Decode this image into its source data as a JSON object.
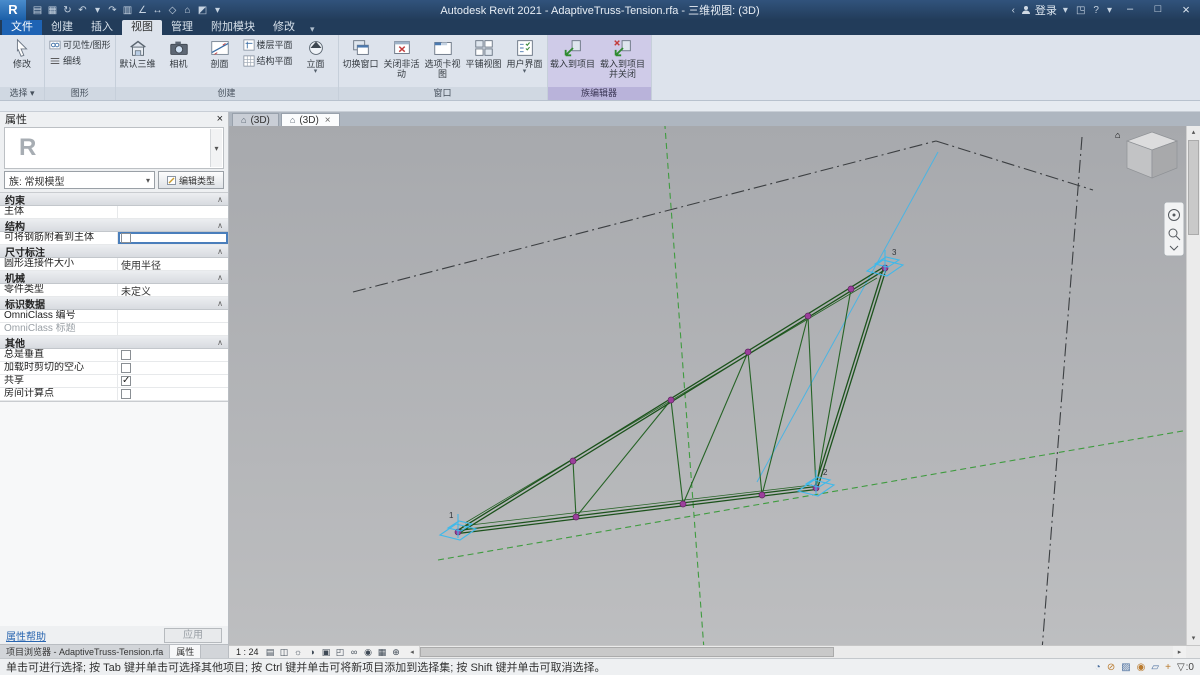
{
  "colors": {
    "titlebar": "#223c5a",
    "file_tab_blue": "#1e63b4",
    "ribbon_bg": "#dde3ec",
    "family_panel": "#cfcbe8",
    "truss_green": "#1c521c",
    "node_purple": "#9c3f9c",
    "reference_green": "#3f9b3f",
    "adaptive_blue": "#3fb9ea",
    "viewport_gray_top": "#a7a9ad",
    "viewport_gray_bottom": "#bdbec0"
  },
  "icons": {
    "dropdown": "▾",
    "close": "×",
    "house": "⌂",
    "chevron": "∧",
    "left": "◂",
    "right": "▸",
    "up": "▴",
    "down": "▾",
    "back": "‹",
    "store": "◳",
    "help": "?",
    "minimize": "–",
    "maximize": "□"
  },
  "titlebar": {
    "logo": "R",
    "title": "Autodesk Revit 2021 - AdaptiveTruss-Tension.rfa - 三维视图: (3D)",
    "qat": [
      {
        "name": "open",
        "glyph": "▤"
      },
      {
        "name": "save",
        "glyph": "▦"
      },
      {
        "name": "sync",
        "glyph": "↻"
      },
      {
        "name": "undo",
        "glyph": "↶"
      },
      {
        "name": "undo-dropdown",
        "glyph": "▾"
      },
      {
        "name": "redo",
        "glyph": "↷"
      },
      {
        "name": "print",
        "glyph": "▥"
      },
      {
        "name": "measure",
        "glyph": "∠"
      },
      {
        "name": "aligned-dimension",
        "glyph": "↔"
      },
      {
        "name": "tag",
        "glyph": "◇"
      },
      {
        "name": "default-3d-view",
        "glyph": "⌂"
      },
      {
        "name": "section",
        "glyph": "◩"
      },
      {
        "name": "customize-dropdown",
        "glyph": "▾"
      }
    ],
    "login": "登录"
  },
  "ribbon": {
    "tabs": [
      "文件",
      "创建",
      "插入",
      "视图",
      "管理",
      "附加模块",
      "修改"
    ],
    "active_tab": "视图",
    "panels": [
      {
        "label": "选择 ▾"
      },
      {
        "label": "图形"
      },
      {
        "label": "创建"
      },
      {
        "label": "窗口"
      },
      {
        "label": "族编辑器"
      }
    ],
    "buttons": {
      "modify": "修改",
      "visibility": "可见性/图形",
      "thin_lines": "细线",
      "default_3d": "默认三维",
      "camera": "相机",
      "section": "剖面",
      "floor_plan": "楼层平面",
      "structure_plan": "结构平面",
      "elevation": "立面",
      "switch_windows": "切换窗口",
      "close_inactive": "关闭非活动",
      "tab_views": "选项卡视图",
      "tile_views": "平铺视图",
      "user_interface": "用户界面",
      "load_into_project": "载入到项目",
      "load_and_close": "载入到项目并关闭"
    }
  },
  "properties": {
    "title": "属性",
    "preview_letter": "R",
    "type_selector": "族: 常规模型",
    "edit_type": "编辑类型",
    "chevron": "∧",
    "grid": [
      {
        "kind": "group",
        "label": "约束"
      },
      {
        "kind": "text",
        "label": "主体",
        "value": ""
      },
      {
        "kind": "group",
        "label": "结构"
      },
      {
        "kind": "check",
        "label": "可将钢筋附着到主体",
        "checked": false,
        "selected": true
      },
      {
        "kind": "group",
        "label": "尺寸标注"
      },
      {
        "kind": "text",
        "label": "圆形连接件大小",
        "value": "使用半径"
      },
      {
        "kind": "group",
        "label": "机械"
      },
      {
        "kind": "text",
        "label": "零件类型",
        "value": "未定义"
      },
      {
        "kind": "group",
        "label": "标识数据"
      },
      {
        "kind": "text",
        "label": "OmniClass 编号",
        "value": ""
      },
      {
        "kind": "text",
        "label": "OmniClass 标题",
        "value": "",
        "dim": true
      },
      {
        "kind": "group",
        "label": "其他"
      },
      {
        "kind": "check",
        "label": "总是垂直",
        "checked": false
      },
      {
        "kind": "check",
        "label": "加载时剪切的空心",
        "checked": false
      },
      {
        "kind": "check",
        "label": "共享",
        "checked": true
      },
      {
        "kind": "check",
        "label": "房间计算点",
        "checked": false
      }
    ],
    "help_link": "属性帮助",
    "apply": "应用",
    "tabs": [
      {
        "label": "项目浏览器 - AdaptiveTruss-Tension.rfa",
        "active": false
      },
      {
        "label": "属性",
        "active": true
      }
    ]
  },
  "view_tabs": [
    {
      "label": "(3D)",
      "active": false
    },
    {
      "label": "(3D)",
      "active": true
    }
  ],
  "view_control": {
    "scale": "1 : 24",
    "icons": [
      {
        "name": "detail-level",
        "glyph": "▤"
      },
      {
        "name": "visual-style",
        "glyph": "◫"
      },
      {
        "name": "sun-path",
        "glyph": "☼"
      },
      {
        "name": "shadows",
        "glyph": "◑"
      },
      {
        "name": "crop-view",
        "glyph": "▣"
      },
      {
        "name": "show-crop-region",
        "glyph": "◰"
      },
      {
        "name": "temporary-hide-isolate",
        "glyph": "∞"
      },
      {
        "name": "reveal-hidden-elements",
        "glyph": "◉"
      },
      {
        "name": "temporary-view-properties",
        "glyph": "▦"
      },
      {
        "name": "show-constraints",
        "glyph": "⊕"
      }
    ]
  },
  "viewport": {
    "points": [
      "1",
      "2",
      "3"
    ],
    "viewcube_home": "⌂"
  },
  "statusbar": {
    "hint": "单击可进行选择; 按 Tab 键并单击可选择其他项目; 按 Ctrl 键并单击可将新项目添加到选择集; 按 Shift 键并单击可取消选择。",
    "icons": [
      {
        "name": "worksharing",
        "glyph": "◔"
      },
      {
        "name": "select-links",
        "glyph": "⊘"
      },
      {
        "name": "select-underlay-elements",
        "glyph": "▨"
      },
      {
        "name": "select-pinned-elements",
        "glyph": "◉"
      },
      {
        "name": "select-elements-by-face",
        "glyph": "▱"
      },
      {
        "name": "drag-elements-on-selection",
        "glyph": "+"
      }
    ],
    "filter_glyph": "▽",
    "filter_count": ":0"
  }
}
